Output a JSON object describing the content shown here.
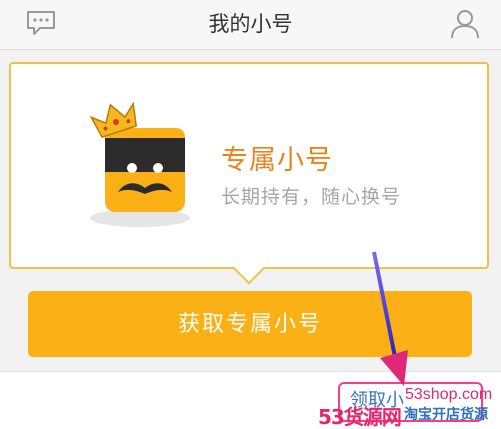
{
  "header": {
    "title": "我的小号",
    "left_icon": "message-icon",
    "right_icon": "user-icon"
  },
  "promo": {
    "title": "专属小号",
    "subtitle": "长期持有，随心换号",
    "mascot_icon": "crowned-mustache-mascot"
  },
  "action": {
    "get_button_label": "获取专属小号"
  },
  "bottom": {
    "link_label": "领取小"
  },
  "watermark": {
    "url": "53shop.com",
    "brand": "53货源网",
    "tagline": "淘宝开店货源"
  },
  "colors": {
    "accent": "#fbb015",
    "title_orange": "#e8841e",
    "card_border": "#f0c24a",
    "arrow": "#5a3fd6",
    "watermark_pink": "#e8266c"
  }
}
